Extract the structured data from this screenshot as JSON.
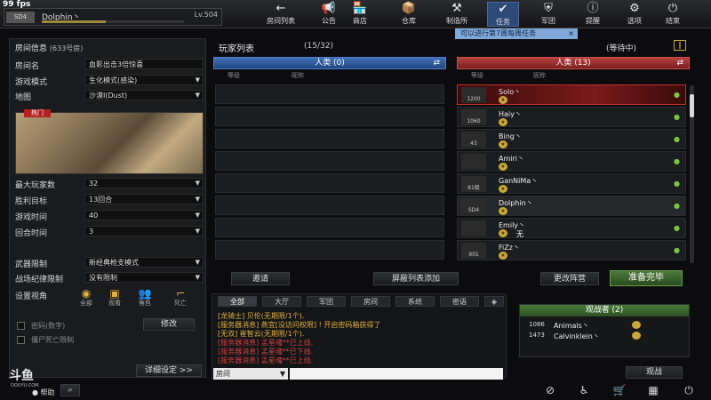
{
  "fps": "99 fps",
  "player": {
    "badge": "SD4",
    "name": "Dolphin丶",
    "level": "Lv.504",
    "xp_fraction": 0.45
  },
  "nav": [
    {
      "icon": "←",
      "label": "房间列表",
      "name": "nav-room-list"
    },
    {
      "icon": "📢",
      "label": "公告",
      "name": "nav-announcement"
    },
    {
      "icon": "🏪",
      "label": "商店",
      "name": "nav-shop"
    },
    {
      "icon": "📦",
      "label": "仓库",
      "name": "nav-warehouse"
    },
    {
      "icon": "⚒",
      "label": "制造所",
      "name": "nav-workshop"
    },
    {
      "icon": "✔",
      "label": "任务",
      "name": "nav-tasks"
    },
    {
      "icon": "⛨",
      "label": "军团",
      "name": "nav-legion"
    },
    {
      "icon": "ⓘ",
      "label": "提醒",
      "name": "nav-reminder"
    },
    {
      "icon": "⚙",
      "label": "选项",
      "name": "nav-options"
    },
    {
      "icon": "⏻",
      "label": "结束",
      "name": "nav-exit"
    }
  ],
  "task_banner": "可以进行第7周每周任务",
  "room": {
    "title": "房间信息",
    "room_no": "(633号房)",
    "fields": [
      {
        "label": "房间名",
        "value": "血影出击3倍惊喜"
      },
      {
        "label": "游戏模式",
        "value": "生化模式(感染)"
      },
      {
        "label": "地图",
        "value": "沙漠Ⅰ(Dust)"
      }
    ],
    "hot_badge": "热门",
    "fields2": [
      {
        "label": "最大玩家数",
        "value": "32"
      },
      {
        "label": "胜利目标",
        "value": "13回合"
      },
      {
        "label": "游戏时间",
        "value": "40"
      },
      {
        "label": "回合时间",
        "value": "3"
      }
    ],
    "fields3": [
      {
        "label": "武器限制",
        "value": "新经典枪支模式"
      },
      {
        "label": "战场纪律限制",
        "value": "没有限制"
      }
    ],
    "view_label": "设置视角",
    "views": [
      "全部",
      "观看",
      "角色",
      "死亡"
    ],
    "password_label": "密码(数字)",
    "modify_label": "修改",
    "no_drop_label": "僵尸死亡限制",
    "detail_btn": "详细设定 >>"
  },
  "player_list": {
    "title": "玩家列表",
    "count": "(15/32)",
    "status": "(等待中)"
  },
  "teams": {
    "blue": {
      "name": "人类 (0)",
      "col_level": "等级",
      "col_name": "昵称"
    },
    "red": {
      "name": "人类 (13)",
      "col_level": "等级",
      "col_name": "昵称"
    }
  },
  "red_players": [
    {
      "rank": "1200",
      "name": "Solo丶"
    },
    {
      "rank": "1060",
      "name": "Haiy丶"
    },
    {
      "rank": "43",
      "name": "Bing丶"
    },
    {
      "rank": "",
      "name": "Amiri丶"
    },
    {
      "rank": "81级",
      "name": "GanNiMa丶"
    },
    {
      "rank": "SD4",
      "name": "Dolphin丶"
    },
    {
      "rank": "",
      "name": "Emily丶",
      "tag": "无"
    },
    {
      "rank": "901",
      "name": "FiZz丶"
    }
  ],
  "buttons": {
    "invite": "邀请",
    "block_add": "屏蔽列表添加",
    "change_team": "更改阵营",
    "ready": "准备完毕",
    "spectate": "观战"
  },
  "chat": {
    "tabs": [
      "全部",
      "大厅",
      "军团",
      "房间",
      "系统",
      "密语"
    ],
    "lines": [
      {
        "text": "[龙骑士] 贝伦(无期限/1个).",
        "color": "#e0b040"
      },
      {
        "text": "[服务器消息] 燕宜[没访问权限] ! 开启密码箱获得了",
        "color": "#e0b040"
      },
      {
        "text": "[无双] 崔智云(无期限/1个).",
        "color": "#e0b040"
      },
      {
        "text": "[服务器消息] 孟星魂**已上线.",
        "color": "#d04040"
      },
      {
        "text": "[服务器消息] 孟星魂**已下线.",
        "color": "#d04040"
      },
      {
        "text": "[服务器消息] 孟星魂**已上线.",
        "color": "#d04040"
      }
    ],
    "channel": "房间"
  },
  "spectators": {
    "title": "观战者 (2)",
    "list": [
      {
        "rank": "1086",
        "name": "Animals丶"
      },
      {
        "rank": "1473",
        "name": "Calvinklein丶"
      }
    ]
  },
  "watermark": {
    "logo": "斗鱼",
    "sub": "DOUYU.COM"
  },
  "help": "帮助",
  "colors": {
    "blue_team": "#3f6fb7",
    "red_team": "#b73f3f",
    "accent_gold": "#e0b040",
    "ready_green": "#3a6a2a"
  }
}
